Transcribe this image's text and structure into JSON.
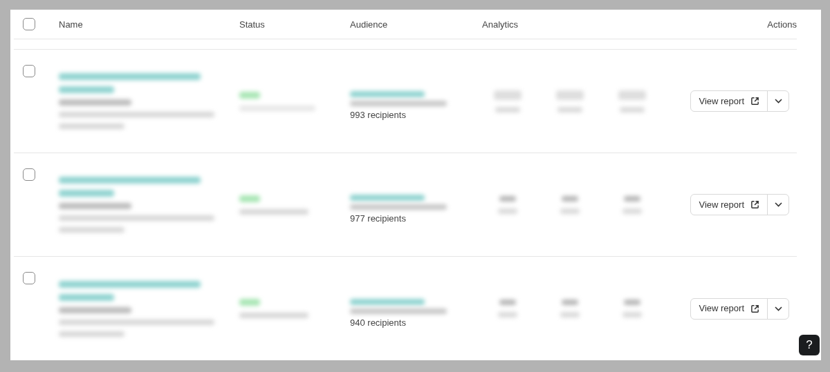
{
  "table": {
    "header_checked": false,
    "columns": [
      {
        "kind": "name",
        "label": "Name"
      },
      {
        "kind": "status",
        "label": "Status"
      },
      {
        "kind": "audience",
        "label": "Audience"
      },
      {
        "kind": "analytics",
        "label": "Analytics"
      },
      {
        "kind": "actions",
        "label": "Actions"
      }
    ],
    "rows": [
      {
        "checked": false,
        "recipients": "993 recipients",
        "action": "View report"
      },
      {
        "checked": false,
        "recipients": "977 recipients",
        "action": "View report"
      },
      {
        "checked": false,
        "recipients": "940 recipients",
        "action": "View report"
      }
    ]
  },
  "help_button": "?"
}
